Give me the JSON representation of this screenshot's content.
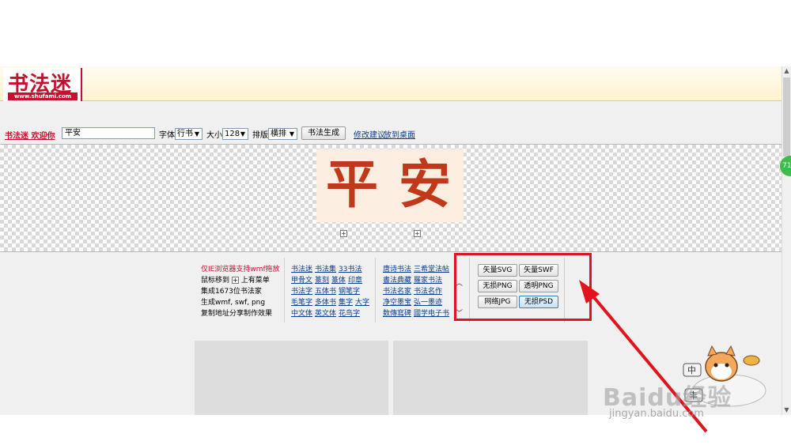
{
  "header": {
    "logo_text": "书法迷",
    "logo_url": "www.shufami.com"
  },
  "toolbar": {
    "welcome": "书法迷 欢迎你",
    "input_value": "平安",
    "font_label": "字体",
    "font_value": "行书",
    "size_label": "大小",
    "size_value": "128",
    "layout_label": "排版",
    "layout_value": "横排",
    "generate_button": "书法生成",
    "link_suggest": "修改建议",
    "link_desktop": "放到桌面"
  },
  "canvas": {
    "char1": "平",
    "char2": "安",
    "plus1": "+",
    "plus2": "+"
  },
  "info": {
    "line1": "仅IE浏览器支持wmf拖放",
    "line2a": "鼠标移到",
    "line2b": "上有菜单",
    "line3": "集成1673位书法家",
    "line4": "生成wmf, swf, png",
    "line5": "复制地址分享制作效果",
    "plus": "+"
  },
  "links_col1": [
    [
      "书法迷",
      "书法集",
      "33书法"
    ],
    [
      "甲骨文",
      "篆刻",
      "篆体",
      "印章"
    ],
    [
      "书法字",
      "五体书",
      "钢笔字"
    ],
    [
      "毛笔字",
      "多体书",
      "集字",
      "大字"
    ],
    [
      "中文体",
      "英文体",
      "花鸟字"
    ]
  ],
  "links_col2": [
    [
      "唐诗书法",
      "三希堂法帖"
    ],
    [
      "書法典藏",
      "羅家书法"
    ],
    [
      "书法名家",
      "书法名作"
    ],
    [
      "净空墨宝",
      "弘一墨迹"
    ],
    [
      "数傳寫碑",
      "國学电子书"
    ]
  ],
  "formats": [
    {
      "label": "矢量SVG"
    },
    {
      "label": "矢量SWF"
    },
    {
      "label": "无损PNG"
    },
    {
      "label": "透明PNG"
    },
    {
      "label": "网络JPG"
    },
    {
      "label": "无损PSD"
    }
  ],
  "side_badge": "71",
  "scroll": {
    "up": "▲",
    "down": "▼",
    "arrows_up": "︿",
    "arrows_down": "﹀"
  },
  "watermark": {
    "brand": "Baidu经验",
    "sub": "jingyan.baidu.com",
    "mascot_text1": "中",
    "mascot_text2": "丰"
  },
  "colors": {
    "brand_red": "#c8102e",
    "link_blue": "#0b3d91",
    "annotation_red": "#e0141c"
  }
}
